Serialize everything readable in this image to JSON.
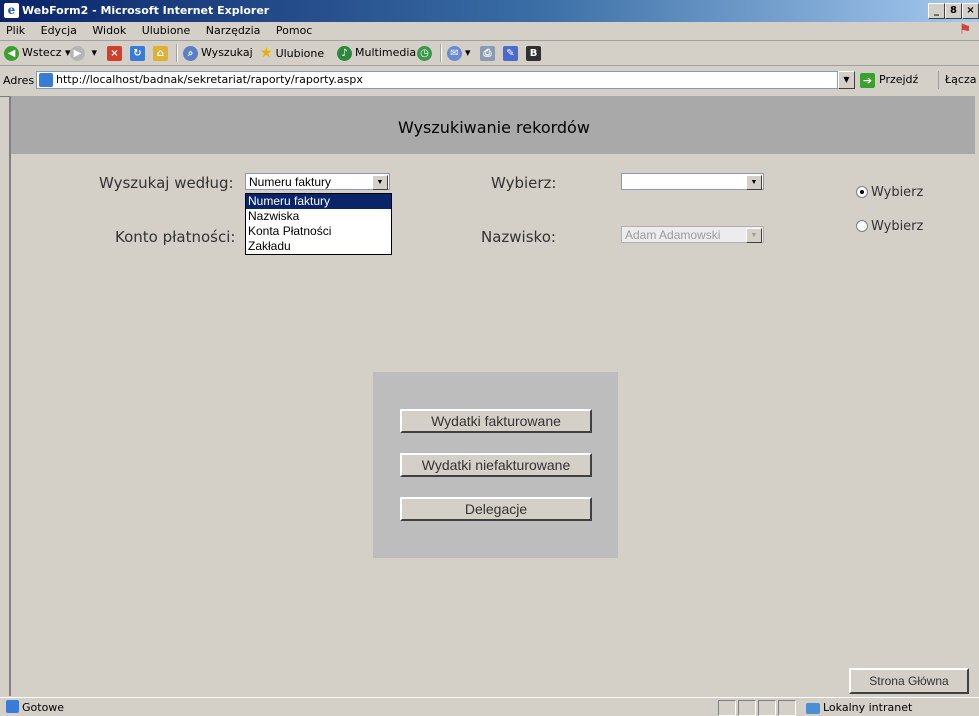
{
  "window": {
    "title": "WebForm2 - Microsoft Internet Explorer",
    "controls": [
      "_",
      "8",
      "×"
    ]
  },
  "menu": [
    "Plik",
    "Edycja",
    "Widok",
    "Ulubione",
    "Narzędzia",
    "Pomoc"
  ],
  "toolbar": {
    "back": "Wstecz",
    "search": "Wyszukaj",
    "favorites": "Ulubione",
    "media": "Multimedia"
  },
  "address": {
    "label": "Adres",
    "url": "http://localhost/badnak/sekretariat/raporty/raporty.aspx",
    "go": "Przejdź",
    "links": "Łącza"
  },
  "page": {
    "header": "Wyszukiwanie rekordów",
    "search_by_label": "Wyszukaj według:",
    "search_by_value": "Numeru faktury",
    "search_by_options": [
      "Numeru faktury",
      "Nazwiska",
      "Konta Płatności",
      "Zakładu"
    ],
    "choose_label": "Wybierz:",
    "choose_value": "",
    "account_label": "Konto płatności:",
    "surname_label": "Nazwisko:",
    "surname_value": "Adam Adamowski",
    "radio1": "Wybierz",
    "radio2": "Wybierz",
    "btn_invoiced": "Wydatki fakturowane",
    "btn_uninvoiced": "Wydatki niefakturowane",
    "btn_delegation": "Delegacje",
    "btn_home": "Strona Główna"
  },
  "status": {
    "text": "Gotowe",
    "zone": "Lokalny intranet"
  }
}
